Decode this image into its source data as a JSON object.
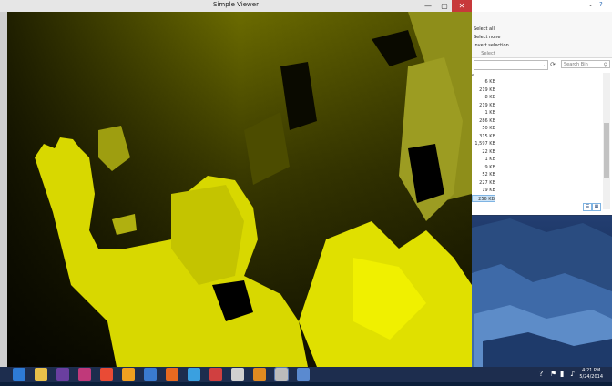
{
  "viewer": {
    "title": "Simple Viewer",
    "minimize": "—",
    "maximize": "▢",
    "close": "✕"
  },
  "explorer": {
    "help": "?",
    "chevron": "⌄",
    "ribbon": {
      "select_all": "Select all",
      "select_none": "Select none",
      "invert_selection": "Invert selection",
      "group_label": "Select"
    },
    "search_placeholder": "Search Bin",
    "column_header": "e",
    "sizes": [
      "6 KB",
      "219 KB",
      "8 KB",
      "219 KB",
      "1 KB",
      "286 KB",
      "50 KB",
      "315 KB",
      "1,597 KB",
      "22 KB",
      "1 KB",
      "9 KB",
      "52 KB",
      "227 KB",
      "19 KB",
      "256 KB"
    ],
    "selected_index": 15
  },
  "taskbar": {
    "icons": [
      "ie-icon",
      "file-explorer-icon",
      "photo-app-icon",
      "media-app-icon",
      "chrome-icon",
      "winamp-icon",
      "mail-icon",
      "media-player-icon",
      "paint-icon",
      "java-icon",
      "shell-icon",
      "blender-icon",
      "viewer-task-icon",
      "video-icon"
    ],
    "tray_help": "?",
    "clock_time": "4:21 PM",
    "clock_date": "5/24/2014"
  }
}
